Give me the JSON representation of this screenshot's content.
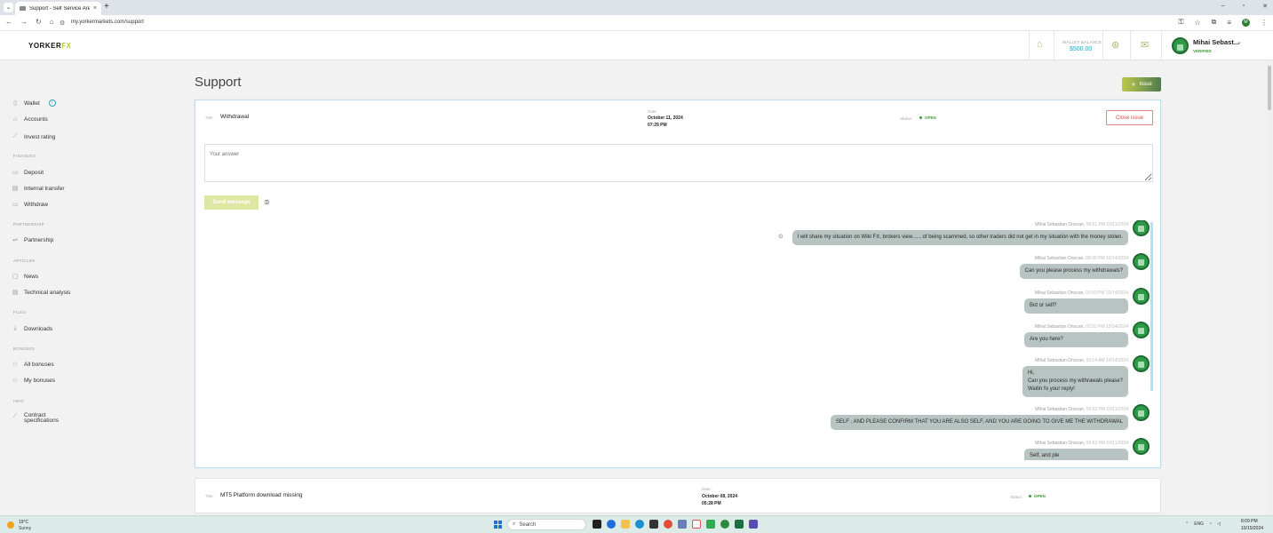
{
  "browser": {
    "tab_title": "Support - Self Service Area | Yo",
    "url": "my.yorkermarkets.com/support"
  },
  "header": {
    "logo_main": "YORKER",
    "logo_accent": "FX",
    "wallet_label": "WALLET BALANCE",
    "wallet_value": "$500.00",
    "user_name": "Mihai Sebast...",
    "user_status": "VERIFIED"
  },
  "sidebar": {
    "wallet": "Wallet",
    "accounts": "Accounts",
    "invest_rating": "Invest rating",
    "finances": "FINANCES",
    "deposit": "Deposit",
    "internal_transfer": "Internal transfer",
    "withdraw": "Withdraw",
    "partnership_section": "PARTNERSHIP",
    "partnership": "Partnership",
    "articles": "ARTICLES",
    "news": "News",
    "technical_analysis": "Technical analysis",
    "files": "FILES",
    "downloads": "Downloads",
    "bonuses": "BONUSES",
    "all_bonuses": "All bonuses",
    "my_bonuses": "My bonuses",
    "info": "INFO",
    "contract_1": "Contract",
    "contract_2": "specifications"
  },
  "main": {
    "page_title": "Support",
    "issue_button": "Issue"
  },
  "ticket": {
    "title_label": "Title:",
    "title": "Withdrawal",
    "date_label": "Date:",
    "date": "October 11, 2024",
    "time": "07:29 PM",
    "status_label": "Status:",
    "status": "OPEN",
    "close_button": "Close issue",
    "answer_placeholder": "Your answer",
    "send_button": "Send message",
    "messages": [
      {
        "author": "Mihai Sebastian Onocan,",
        "time": "08:01 PM 10/11/2024",
        "lines": [
          "I will share my situation on Wiki FX, brokers view....., of being scammed, so other traders did not get in my situation with the money stolen."
        ]
      },
      {
        "author": "Mihai Sebastian Onocan,",
        "time": "08:30 PM 10/14/2024",
        "lines": [
          "Can you please process my withdrawals?"
        ]
      },
      {
        "author": "Mihai Sebastian Onocan,",
        "time": "02:53 PM 10/14/2024",
        "lines": [
          "Bot or self?"
        ]
      },
      {
        "author": "Mihai Sebastian Onocan,",
        "time": "02:52 PM 10/14/2024",
        "lines": [
          "Are you here?"
        ]
      },
      {
        "author": "Mihai Sebastian Onocan,",
        "time": "09:14 AM 10/14/2024",
        "lines": [
          "Hi,",
          "Can you process my withrawals please?",
          "Waitin fo your reply!"
        ]
      },
      {
        "author": "Mihai Sebastian Onocan,",
        "time": "08:53 PM 10/11/2024",
        "lines": [
          "SELF , AND PLEASE CONFIRM THAT YOU ARE ALSO SELF, AND YOU ARE GOING TO GIVE ME THE WITHDRAWAL"
        ]
      },
      {
        "author": "Mihai Sebastian Onocan,",
        "time": "08:53 PM 10/11/2024",
        "lines": [
          "Self, and ple"
        ]
      }
    ]
  },
  "ticket2": {
    "title_label": "Title:",
    "title": "MT5 Platform download missing",
    "date_label": "Date:",
    "date": "October 08, 2024",
    "time": "05:28 PM",
    "status_label": "Status:",
    "status": "OPEN"
  },
  "taskbar": {
    "temp": "19°C",
    "weather": "Sunny",
    "search": "Search",
    "lang": "ENG",
    "clock_time": "8:09 PM",
    "clock_date": "10/15/2024"
  },
  "colors": {
    "accent": "#b6c936",
    "link": "#2aa6c4",
    "status_open": "#3a9d3a",
    "bubble": "#b8c4c1"
  }
}
